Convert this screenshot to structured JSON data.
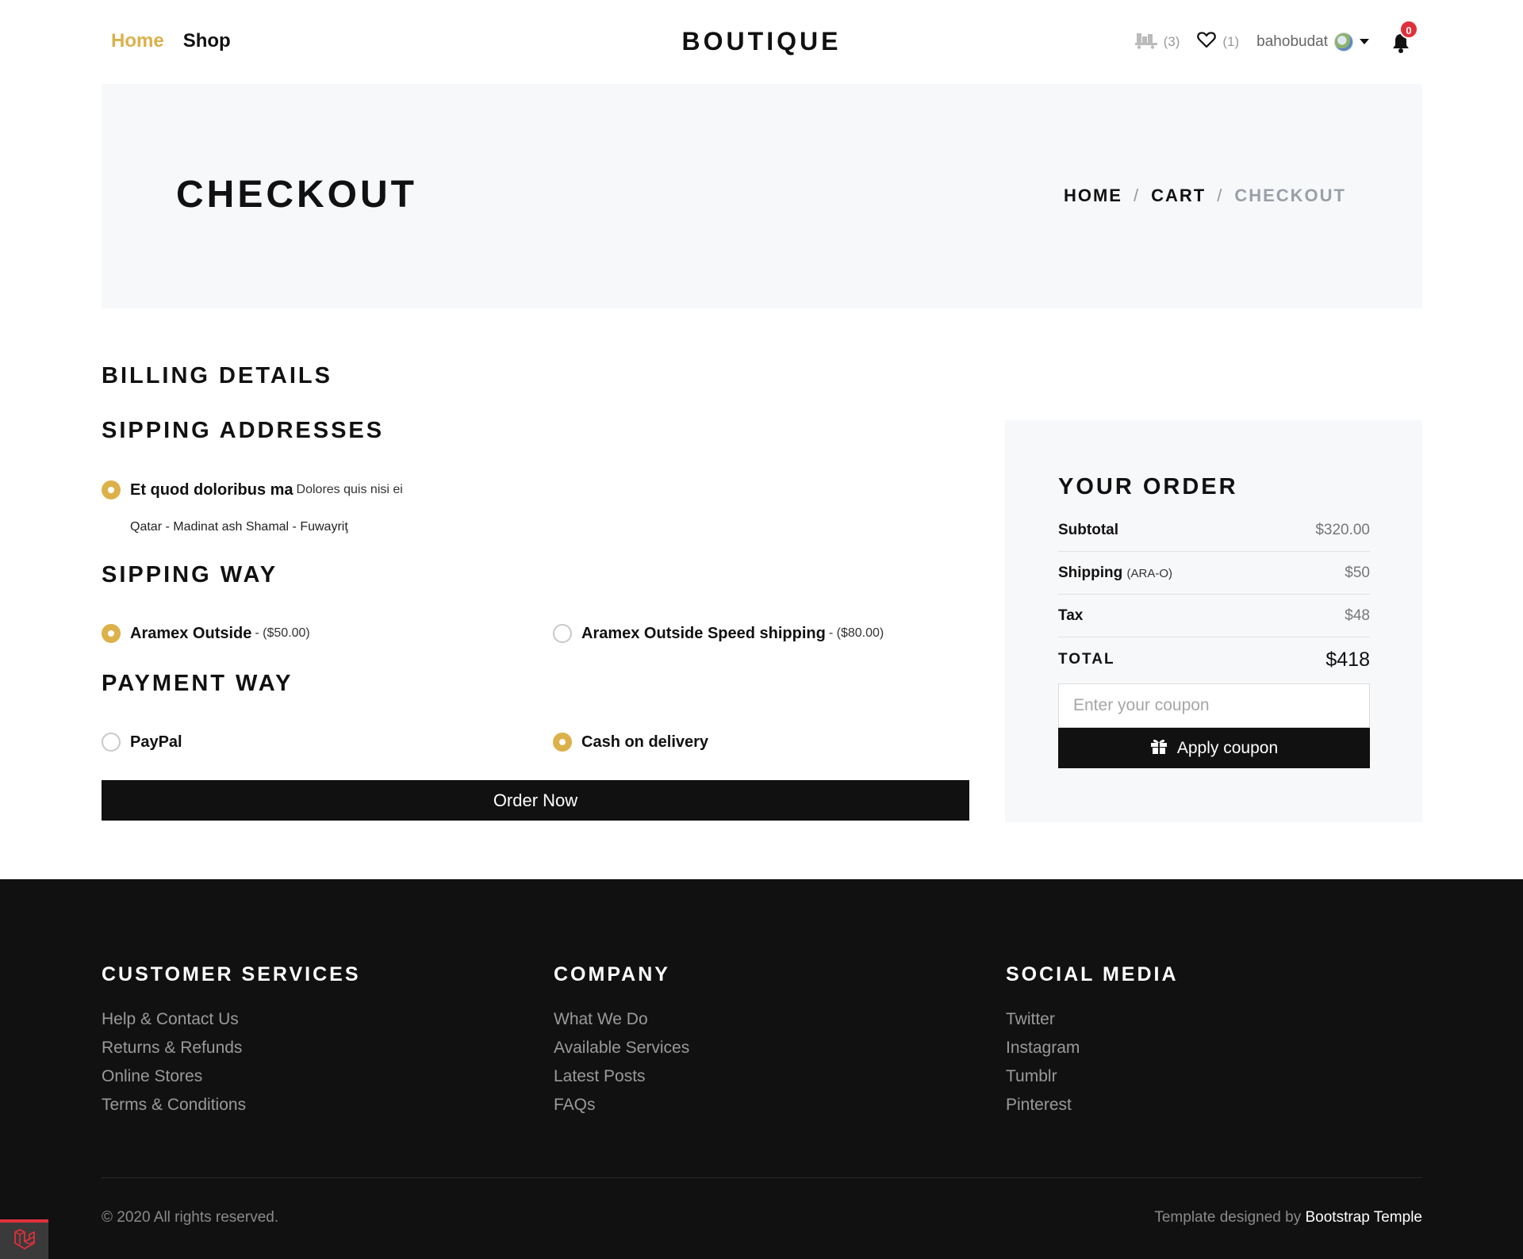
{
  "nav": {
    "links": [
      {
        "label": "Home",
        "active": true
      },
      {
        "label": "Shop",
        "active": false
      }
    ],
    "brand": "BOUTIQUE",
    "cart_icon": "cart-icon",
    "cart_count": "(3)",
    "wishlist_icon": "heart-icon",
    "wishlist_count": "(1)",
    "user_name": "bahobudat",
    "notification_count": "0"
  },
  "hero": {
    "title": "CHECKOUT",
    "breadcrumb": [
      "HOME",
      "CART",
      "CHECKOUT"
    ],
    "separator": "/"
  },
  "billing": {
    "heading": "BILLING DETAILS",
    "address_heading": "SIPPING ADDRESSES",
    "address": {
      "name": "Et quod doloribus ma",
      "street": "Dolores quis nisi ei",
      "location": "Qatar - Madinat ash Shamal - Fuwayriţ",
      "selected": true
    },
    "shipping_heading": "SIPPING WAY",
    "shipping_options": [
      {
        "label": "Aramex Outside",
        "price": "- ($50.00)",
        "selected": true
      },
      {
        "label": "Aramex Outside Speed shipping",
        "price": "- ($80.00)",
        "selected": false
      }
    ],
    "payment_heading": "PAYMENT WAY",
    "payment_options": [
      {
        "label": "PayPal",
        "selected": false
      },
      {
        "label": "Cash on delivery",
        "selected": true
      }
    ],
    "order_button": "Order Now"
  },
  "order": {
    "title": "YOUR ORDER",
    "subtotal_label": "Subtotal",
    "subtotal_value": "$320.00",
    "shipping_label": "Shipping",
    "shipping_note": "(ARA-O)",
    "shipping_value": "$50",
    "tax_label": "Tax",
    "tax_value": "$48",
    "total_label": "TOTAL",
    "total_value": "$418",
    "coupon_placeholder": "Enter your coupon",
    "coupon_button": "Apply coupon"
  },
  "footer": {
    "columns": [
      {
        "heading": "CUSTOMER SERVICES",
        "links": [
          "Help & Contact Us",
          "Returns & Refunds",
          "Online Stores",
          "Terms & Conditions"
        ]
      },
      {
        "heading": "COMPANY",
        "links": [
          "What We Do",
          "Available Services",
          "Latest Posts",
          "FAQs"
        ]
      },
      {
        "heading": "SOCIAL MEDIA",
        "links": [
          "Twitter",
          "Instagram",
          "Tumblr",
          "Pinterest"
        ]
      }
    ],
    "copyright": "© 2020 All rights reserved.",
    "credit_prefix": "Template designed by",
    "credit_link": "Bootstrap Temple"
  },
  "colors": {
    "accent": "#dcb14a",
    "dark": "#111111",
    "hero_bg": "#f7f8fa",
    "badge": "#e0313b"
  }
}
